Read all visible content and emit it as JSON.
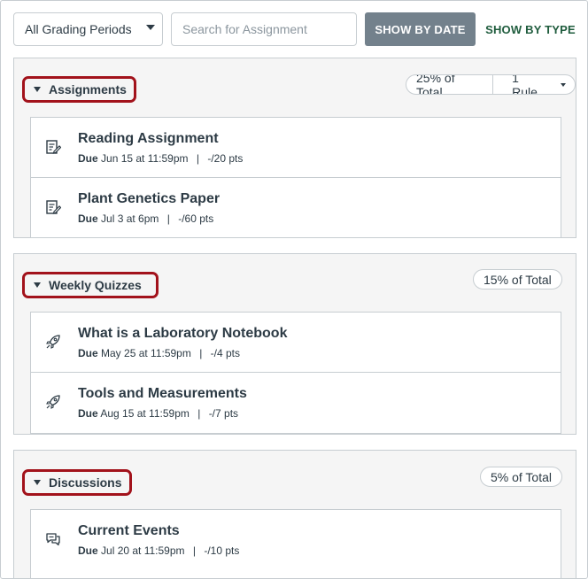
{
  "toolbar": {
    "grading_period": "All Grading Periods",
    "search_placeholder": "Search for Assignment",
    "show_by_date": "SHOW BY DATE",
    "show_by_type": "SHOW BY TYPE"
  },
  "groups": [
    {
      "name": "Assignments",
      "weight": "25% of Total",
      "rules": "1 Rule",
      "items": [
        {
          "icon": "assignment-icon",
          "title": "Reading Assignment",
          "due_label": "Due",
          "due": "Jun 15 at 11:59pm",
          "points": "-/20 pts"
        },
        {
          "icon": "assignment-icon",
          "title": "Plant Genetics Paper",
          "due_label": "Due",
          "due": "Jul 3 at 6pm",
          "points": "-/60 pts"
        }
      ]
    },
    {
      "name": "Weekly Quizzes",
      "weight": "15% of Total",
      "items": [
        {
          "icon": "quiz-rocket-icon",
          "title": "What is a Laboratory Notebook",
          "due_label": "Due",
          "due": "May 25 at 11:59pm",
          "points": "-/4 pts"
        },
        {
          "icon": "quiz-rocket-icon",
          "title": "Tools and Measurements",
          "due_label": "Due",
          "due": "Aug 15 at 11:59pm",
          "points": "-/7 pts"
        }
      ]
    },
    {
      "name": "Discussions",
      "weight": "5% of Total",
      "items": [
        {
          "icon": "discussion-icon",
          "title": "Current Events",
          "due_label": "Due",
          "due": "Jul 20 at 11:59pm",
          "points": "-/10 pts"
        }
      ]
    }
  ],
  "colors": {
    "highlight_border": "#a2121b",
    "button_gray": "#73818c",
    "text": "#2d3b45"
  }
}
